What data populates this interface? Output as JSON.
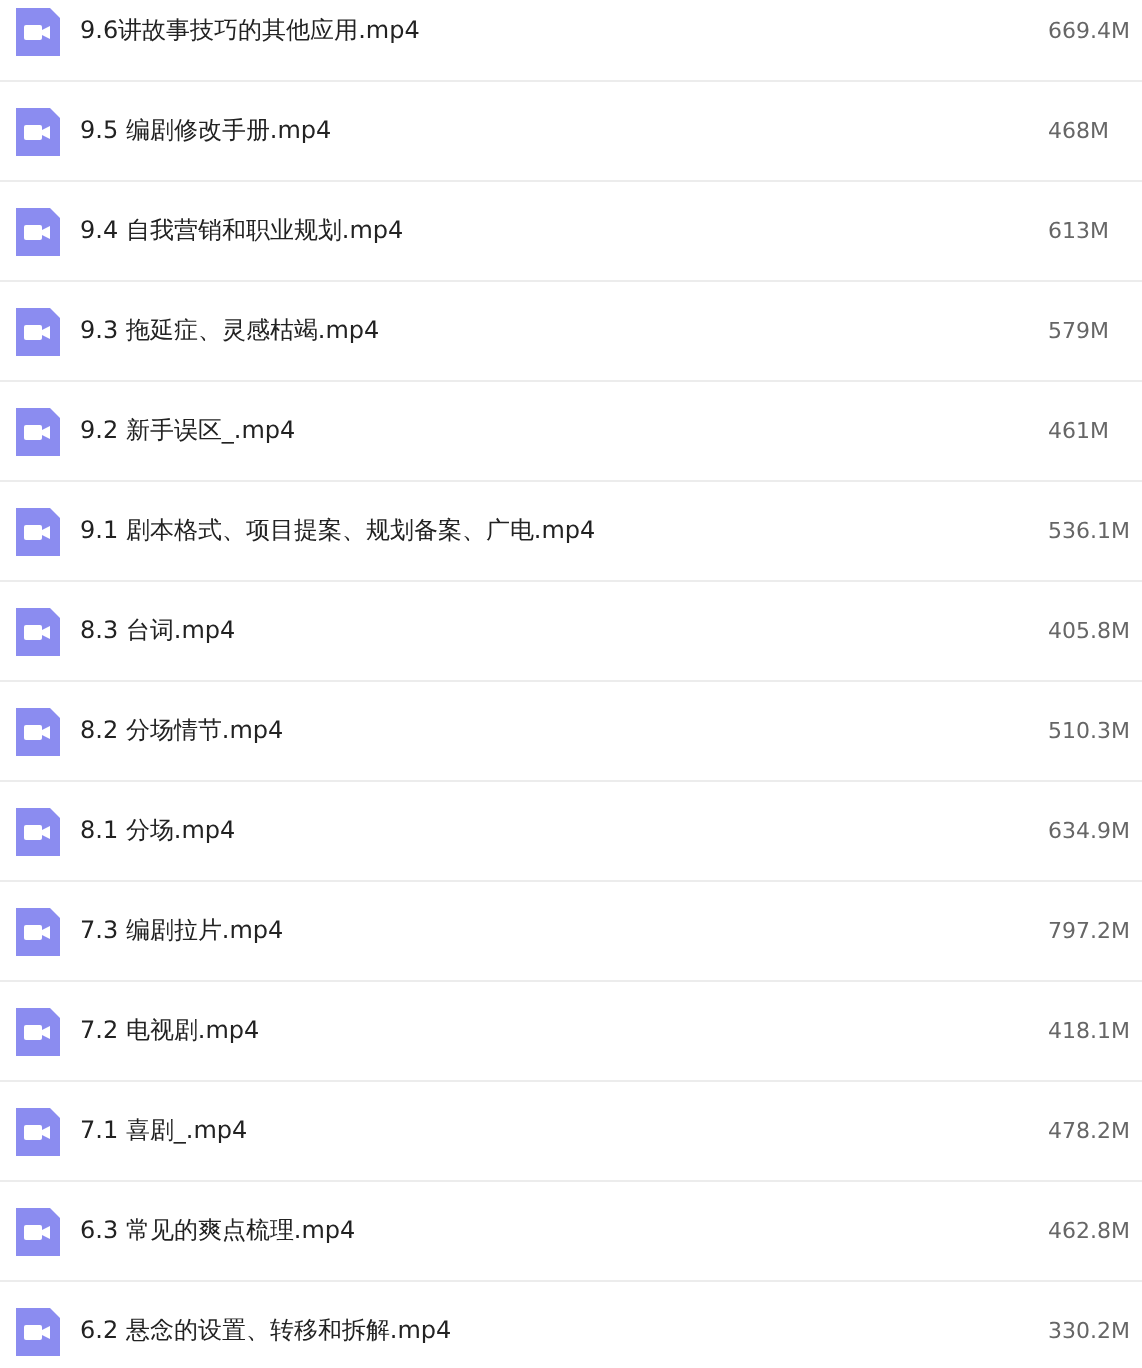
{
  "files": [
    {
      "name": "9.6讲故事技巧的其他应用.mp4",
      "size": "669.4M"
    },
    {
      "name": "9.5 编剧修改手册.mp4",
      "size": "468M"
    },
    {
      "name": "9.4 自我营销和职业规划.mp4",
      "size": "613M"
    },
    {
      "name": "9.3 拖延症、灵感枯竭.mp4",
      "size": "579M"
    },
    {
      "name": "9.2 新手误区_.mp4",
      "size": "461M"
    },
    {
      "name": "9.1 剧本格式、项目提案、规划备案、广电.mp4",
      "size": "536.1M"
    },
    {
      "name": "8.3 台词.mp4",
      "size": "405.8M"
    },
    {
      "name": "8.2 分场情节.mp4",
      "size": "510.3M"
    },
    {
      "name": "8.1 分场.mp4",
      "size": "634.9M"
    },
    {
      "name": "7.3 编剧拉片.mp4",
      "size": "797.2M"
    },
    {
      "name": "7.2 电视剧.mp4",
      "size": "418.1M"
    },
    {
      "name": "7.1 喜剧_.mp4",
      "size": "478.2M"
    },
    {
      "name": "6.3 常见的爽点梳理.mp4",
      "size": "462.8M"
    },
    {
      "name": "6.2 悬念的设置、转移和拆解.mp4",
      "size": "330.2M"
    }
  ]
}
